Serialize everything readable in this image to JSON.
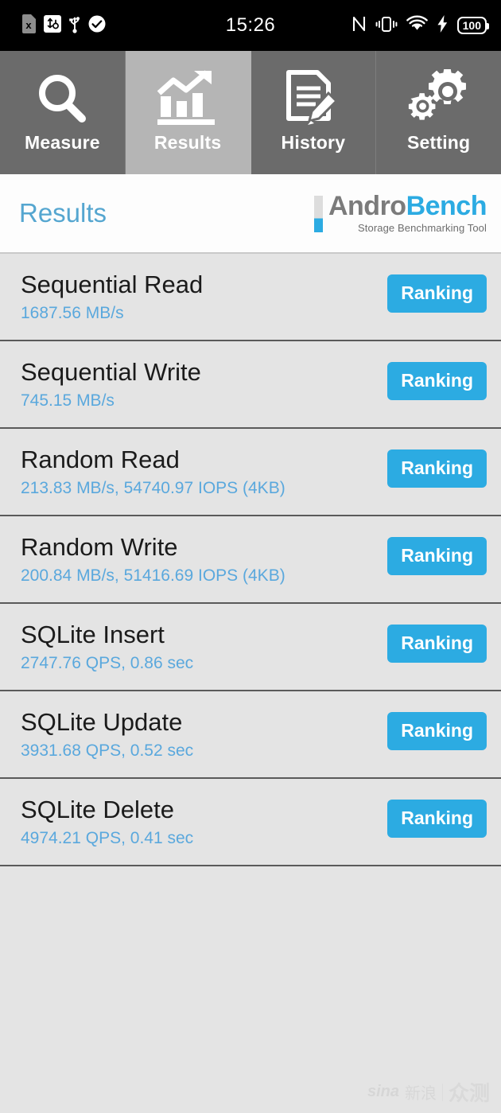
{
  "statusbar": {
    "time": "15:26",
    "left_icons": [
      {
        "name": "sd-card-error-icon",
        "glyph": "sd-x"
      },
      {
        "name": "usb-debugging-icon",
        "glyph": "usb-debug"
      },
      {
        "name": "usb-icon",
        "glyph": "usb"
      },
      {
        "name": "check-circle-icon",
        "glyph": "check"
      }
    ],
    "right_icons": [
      {
        "name": "nfc-icon",
        "glyph": "N"
      },
      {
        "name": "vibrate-icon",
        "glyph": "vibrate"
      },
      {
        "name": "wifi-icon",
        "glyph": "wifi"
      },
      {
        "name": "charging-bolt-icon",
        "glyph": "bolt"
      }
    ],
    "battery_level": "100"
  },
  "tabs": [
    {
      "label": "Measure",
      "icon": "magnifier-icon",
      "selected": false
    },
    {
      "label": "Results",
      "icon": "bar-chart-arrow-icon",
      "selected": true
    },
    {
      "label": "History",
      "icon": "document-pencil-icon",
      "selected": false
    },
    {
      "label": "Setting",
      "icon": "gears-icon",
      "selected": false
    }
  ],
  "header": {
    "page_title": "Results",
    "logo": {
      "word_first": "Andro",
      "word_second": "Bench",
      "subtitle": "Storage Benchmarking Tool",
      "color_gray": "#7b7b7b",
      "color_blue": "#2cabe2"
    }
  },
  "results": {
    "button_label": "Ranking",
    "rows": [
      {
        "title": "Sequential Read",
        "value": "1687.56 MB/s"
      },
      {
        "title": "Sequential Write",
        "value": "745.15 MB/s"
      },
      {
        "title": "Random Read",
        "value": "213.83 MB/s, 54740.97 IOPS (4KB)"
      },
      {
        "title": "Random Write",
        "value": "200.84 MB/s, 51416.69 IOPS (4KB)"
      },
      {
        "title": "SQLite Insert",
        "value": "2747.76 QPS, 0.86 sec"
      },
      {
        "title": "SQLite Update",
        "value": "3931.68 QPS, 0.52 sec"
      },
      {
        "title": "SQLite Delete",
        "value": "4974.21 QPS, 0.41 sec"
      }
    ]
  },
  "watermark": {
    "brand_latin": "sina",
    "brand_cn": "新浪",
    "section_cn": "众测"
  },
  "colors": {
    "accent_blue": "#2cabe2",
    "value_blue": "#5aa8dd",
    "tab_unselected": "#6b6b6b",
    "tab_selected": "#b5b5b5",
    "page_bg": "#e4e4e4"
  }
}
